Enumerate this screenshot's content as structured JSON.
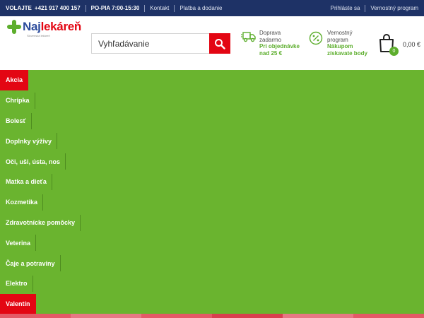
{
  "topbar": {
    "call_label": "VOLAJTE",
    "phone": "+421 917 400 157",
    "hours": "PO-PIA 7:00-15:30",
    "contact": "Kontakt",
    "payment": "Platba a dodanie",
    "login": "Prihláste sa",
    "loyalty": "Vernostný program"
  },
  "logo": {
    "part1": "Naj",
    "part2": "lekáreň",
    "tagline": "Slovenská lekáreň",
    "brand_blue": "#2c4c9c",
    "brand_red": "#e30613",
    "brand_green": "#5dae2d"
  },
  "search": {
    "placeholder": "Vyhľadávanie",
    "icon": "search-icon"
  },
  "shipping": {
    "line1": "Doprava",
    "line2": "zadarmo",
    "highlight1": "Pri objednávke",
    "highlight2": "nad 25 €",
    "icon": "truck-icon"
  },
  "loyalty_box": {
    "line1": "Vernostný",
    "line2": "program",
    "highlight1": "Nákupom",
    "highlight2": "získavate body",
    "icon": "percent-icon"
  },
  "cart": {
    "count": "0",
    "total": "0,00 €",
    "icon": "bag-icon"
  },
  "menu": {
    "items": [
      {
        "label": "Akcia",
        "highlight": true
      },
      {
        "label": "Chrípka",
        "highlight": false
      },
      {
        "label": "Bolesť",
        "highlight": false
      },
      {
        "label": "Doplnky výživy",
        "highlight": false
      },
      {
        "label": "Oči, uši, ústa, nos",
        "highlight": false
      },
      {
        "label": "Matka a dieťa",
        "highlight": false
      },
      {
        "label": "Kozmetika",
        "highlight": false
      },
      {
        "label": "Zdravotnícke pomôcky",
        "highlight": false
      },
      {
        "label": "Veterina",
        "highlight": false
      },
      {
        "label": "Čaje a potraviny",
        "highlight": false
      },
      {
        "label": "Elektro",
        "highlight": false
      },
      {
        "label": "Valentín",
        "highlight": true
      }
    ],
    "background": "#6ab42f",
    "accent": "#e30613"
  }
}
